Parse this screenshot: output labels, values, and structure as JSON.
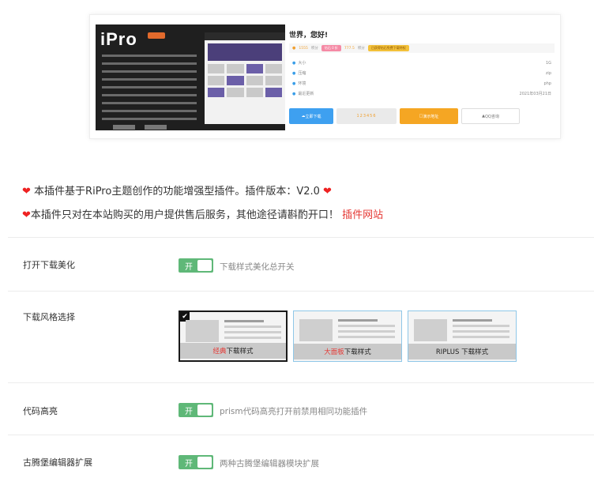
{
  "preview": {
    "brand": "iPro",
    "title": "世界，您好!",
    "price_pay": "1555",
    "price_unit": "积分",
    "vip_pill": "钻石 0 折",
    "vip_price": "777.5",
    "vip_unit": "积分",
    "buy_pill": "已获得钻石免费下载特权",
    "props": [
      {
        "name": "大小",
        "value": "1G"
      },
      {
        "name": "压缩",
        "value": "zip"
      },
      {
        "name": "环境",
        "value": "php"
      },
      {
        "name": "最近更新",
        "value": "2021年03月21日"
      }
    ],
    "btn_download": "立即下载",
    "btn_code": "123456",
    "btn_demo": "演示地址",
    "btn_qq": "QQ咨询"
  },
  "notices": {
    "line1": "本插件基于RiPro主题创作的功能增强型插件。插件版本：V2.0",
    "line2": "本插件只对在本站购买的用户提供售后服务，其他途径请斟酌开口！",
    "link": "插件网站"
  },
  "settings": {
    "download_beautify": {
      "label": "打开下载美化",
      "switch": "开",
      "desc": "下载样式美化总开关"
    },
    "style_select": {
      "label": "下载风格选择",
      "options": [
        {
          "accent": "经典",
          "rest": "下载样式",
          "selected": true
        },
        {
          "accent": "大面板",
          "rest": "下载样式",
          "selected": false
        },
        {
          "accent": "",
          "rest": "RIPLUS 下载样式",
          "selected": false
        }
      ]
    },
    "code_highlight": {
      "label": "代码高亮",
      "switch": "开",
      "desc": "prism代码高亮打开前禁用相同功能插件"
    },
    "gutenberg_ext": {
      "label": "古腾堡编辑器扩展",
      "switch": "开",
      "desc": "两种古腾堡编辑器模块扩展"
    }
  },
  "colors": {
    "switch_on": "#5fb878",
    "heart": "#e22222",
    "link": "#e53935",
    "selected_border": "#1a1a1a",
    "option_border": "#8fc7e8"
  }
}
